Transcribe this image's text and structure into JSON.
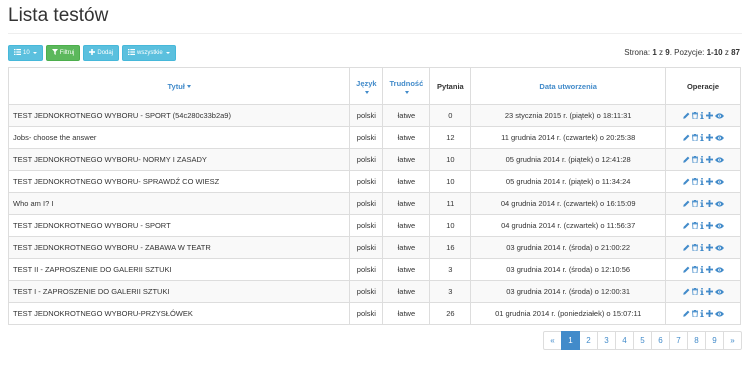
{
  "page": {
    "title": "Lista testów"
  },
  "toolbar": {
    "per_page_label": "10",
    "filter_label": "Filtruj",
    "add_label": "Dodaj",
    "scope_label": "wszystkie"
  },
  "paging_info": {
    "page_prefix": "Strona:",
    "page_current": "1",
    "page_of": "z",
    "page_total": "9",
    "items_prefix": ". Pozycje:",
    "items_range": "1-10",
    "items_of": "z",
    "items_total": "87"
  },
  "table": {
    "headers": {
      "title": "Tytuł",
      "language": "Język",
      "difficulty": "Trudność",
      "questions": "Pytania",
      "created": "Data utworzenia",
      "operations": "Operacje"
    },
    "rows": [
      {
        "title": "TEST JEDNOKROTNEGO WYBORU - SPORT (54c280c33b2a9)",
        "language": "polski",
        "difficulty": "łatwe",
        "questions": "0",
        "created": "23 stycznia 2015 r. (piątek) o 18:11:31"
      },
      {
        "title": "Jobs- choose the answer",
        "language": "polski",
        "difficulty": "łatwe",
        "questions": "12",
        "created": "11 grudnia 2014 r. (czwartek) o 20:25:38"
      },
      {
        "title": "TEST JEDNOKROTNEGO WYBORU- NORMY I ZASADY",
        "language": "polski",
        "difficulty": "łatwe",
        "questions": "10",
        "created": "05 grudnia 2014 r. (piątek) o 12:41:28"
      },
      {
        "title": "TEST JEDNOKROTNEGO WYBORU- SPRAWDŹ CO WIESZ",
        "language": "polski",
        "difficulty": "łatwe",
        "questions": "10",
        "created": "05 grudnia 2014 r. (piątek) o 11:34:24"
      },
      {
        "title": "Who am I? I",
        "language": "polski",
        "difficulty": "łatwe",
        "questions": "11",
        "created": "04 grudnia 2014 r. (czwartek) o 16:15:09"
      },
      {
        "title": "TEST JEDNOKROTNEGO WYBORU - SPORT",
        "language": "polski",
        "difficulty": "łatwe",
        "questions": "10",
        "created": "04 grudnia 2014 r. (czwartek) o 11:56:37"
      },
      {
        "title": "TEST JEDNOKROTNEGO WYBORU - ZABAWA W TEATR",
        "language": "polski",
        "difficulty": "łatwe",
        "questions": "16",
        "created": "03 grudnia 2014 r. (środa) o 21:00:22"
      },
      {
        "title": "TEST II - ZAPROSZENIE DO GALERII SZTUKI",
        "language": "polski",
        "difficulty": "łatwe",
        "questions": "3",
        "created": "03 grudnia 2014 r. (środa) o 12:10:56"
      },
      {
        "title": "TEST I - ZAPROSZENIE DO GALERII SZTUKI",
        "language": "polski",
        "difficulty": "łatwe",
        "questions": "3",
        "created": "03 grudnia 2014 r. (środa) o 12:00:31"
      },
      {
        "title": "TEST JEDNOKROTNEGO WYBORU-PRZYSŁÓWEK",
        "language": "polski",
        "difficulty": "łatwe",
        "questions": "26",
        "created": "01 grudnia 2014 r. (poniedziałek) o 15:07:11"
      }
    ],
    "row_operation_icons": [
      "pencil-icon",
      "trash-icon",
      "info-icon",
      "plus-icon",
      "eye-icon"
    ]
  },
  "pagination": {
    "prev": "«",
    "pages": [
      "1",
      "2",
      "3",
      "4",
      "5",
      "6",
      "7",
      "8",
      "9"
    ],
    "active_page": "1",
    "next": "»"
  },
  "colors": {
    "link": "#428bca",
    "info_button": "#5bc0de",
    "success_button": "#5cb85c",
    "row_stripe": "#f9f9f9",
    "border": "#dddddd"
  }
}
